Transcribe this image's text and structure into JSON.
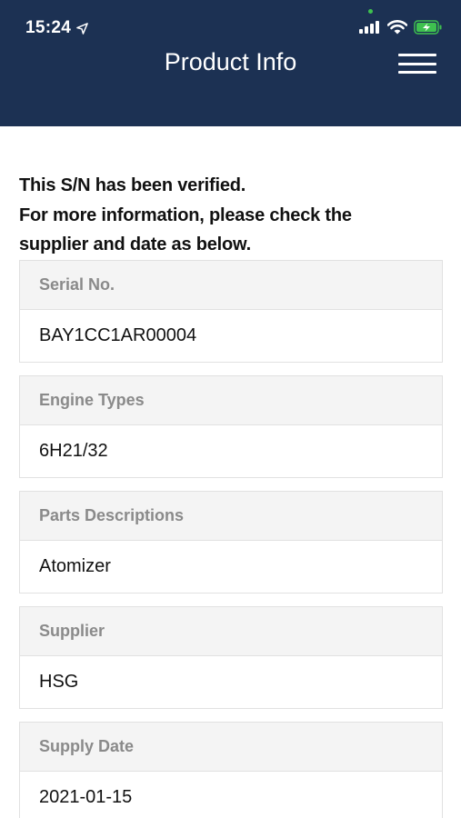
{
  "status_bar": {
    "time": "15:24",
    "icons": [
      "location-arrow-icon",
      "signal-icon",
      "wifi-icon",
      "battery-charging-icon"
    ]
  },
  "header": {
    "title": "Product Info",
    "menu_icon": "hamburger-menu-icon"
  },
  "message": {
    "line1": "This S/N has been verified.",
    "line2": "For more information, please check the",
    "line3": "supplier and date as below."
  },
  "fields": [
    {
      "label": "Serial No.",
      "value": "BAY1CC1AR00004"
    },
    {
      "label": "Engine Types",
      "value": "6H21/32"
    },
    {
      "label": "Parts Descriptions",
      "value": "Atomizer"
    },
    {
      "label": "Supplier",
      "value": "HSG"
    },
    {
      "label": "Supply Date",
      "value": "2021-01-15"
    }
  ],
  "colors": {
    "header_bg": "#1c3153",
    "label_bg": "#f4f4f4",
    "label_text": "#8a8a8a",
    "border": "#e1e1e1",
    "battery_green": "#3ec14f"
  }
}
